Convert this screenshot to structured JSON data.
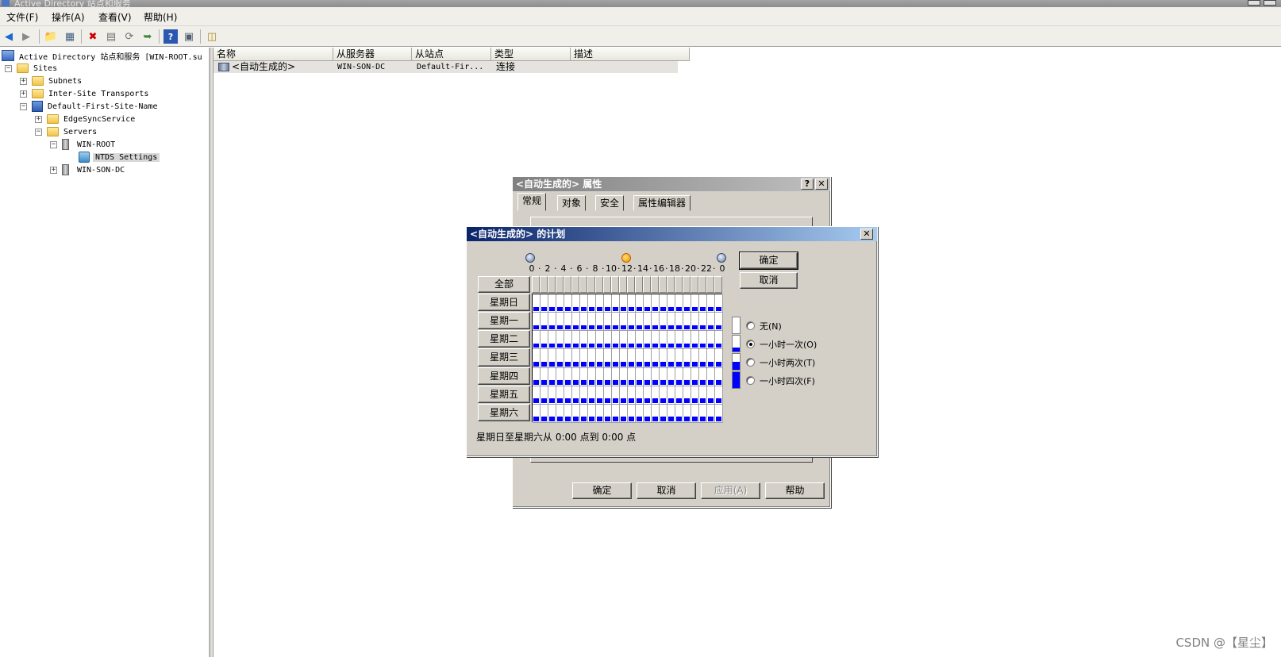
{
  "window": {
    "title": "Active Directory 站点和服务"
  },
  "menu": [
    "文件(F)",
    "操作(A)",
    "查看(V)",
    "帮助(H)"
  ],
  "tree": {
    "root": "Active Directory 站点和服务 [WIN-ROOT.su",
    "sites": "Sites",
    "subnets": "Subnets",
    "inter_site": "Inter-Site Transports",
    "default_site": "Default-First-Site-Name",
    "edgesync": "EdgeSyncService",
    "servers": "Servers",
    "win_root": "WIN-ROOT",
    "ntds": "NTDS Settings",
    "win_son": "WIN-SON-DC"
  },
  "list": {
    "columns": [
      "名称",
      "从服务器",
      "从站点",
      "类型",
      "描述"
    ],
    "rows": [
      {
        "name": "<自动生成的>",
        "from_server": "WIN-SON-DC",
        "from_site": "Default-Fir...",
        "type": "连接",
        "desc": ""
      }
    ]
  },
  "props_dialog": {
    "title": "<自动生成的> 属性",
    "tabs": [
      "常规",
      "对象",
      "安全",
      "属性编辑器"
    ],
    "ok": "确定",
    "cancel": "取消",
    "apply": "应用(A)",
    "help": "帮助"
  },
  "schedule_dialog": {
    "title": "<自动生成的> 的计划",
    "all_label": "全部",
    "days": [
      "星期日",
      "星期一",
      "星期二",
      "星期三",
      "星期四",
      "星期五",
      "星期六"
    ],
    "hour_labels": [
      "0",
      "2",
      "4",
      "6",
      "8",
      "10",
      "12",
      "14",
      "16",
      "18",
      "20",
      "22",
      "0"
    ],
    "ok": "确定",
    "cancel": "取消",
    "options": [
      {
        "label": "无(N)",
        "fill": 0,
        "selected": false
      },
      {
        "label": "一小时一次(O)",
        "fill": 0.25,
        "selected": true
      },
      {
        "label": "一小时两次(T)",
        "fill": 0.5,
        "selected": false
      },
      {
        "label": "一小时四次(F)",
        "fill": 1.0,
        "selected": false
      }
    ],
    "status": "星期日至星期六从  0:00  点到  0:00  点",
    "grid_fill_fraction": 0.25,
    "fill_color": "#0000ff"
  },
  "watermark": "CSDN @【星尘】"
}
